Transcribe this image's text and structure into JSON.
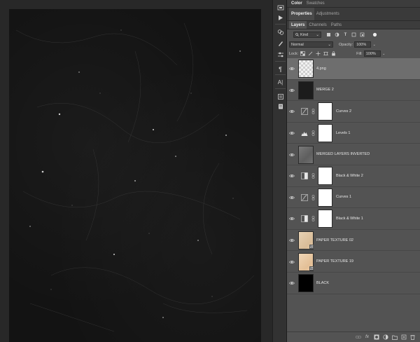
{
  "panels": {
    "top_tabs": [
      "Color",
      "Swatches"
    ],
    "mid_tabs": [
      "Properties",
      "Adjustments"
    ],
    "layer_tabs": [
      "Layers",
      "Channels",
      "Paths"
    ]
  },
  "layers_panel": {
    "filter_kind": "Kind",
    "blend_mode": "Normal",
    "opacity_label": "Opacity:",
    "opacity_value": "100%",
    "lock_label": "Lock:",
    "fill_label": "Fill:",
    "fill_value": "100%"
  },
  "layers": [
    {
      "name": "4.png",
      "kind": "transparent",
      "selected": true
    },
    {
      "name": "MERGE 2",
      "kind": "dark"
    },
    {
      "name": "Curves 2",
      "kind": "adjustment",
      "icon": "curves-icon"
    },
    {
      "name": "Levels 1",
      "kind": "adjustment",
      "icon": "levels-icon"
    },
    {
      "name": "MERGED LAYERS INVERTED",
      "kind": "grey"
    },
    {
      "name": "Black & White 2",
      "kind": "adjustment",
      "icon": "black-white-icon"
    },
    {
      "name": "Curves 1",
      "kind": "adjustment",
      "icon": "curves-icon"
    },
    {
      "name": "Black & White 1",
      "kind": "adjustment",
      "icon": "black-white-icon"
    },
    {
      "name": "PAPER TEXTURE 02",
      "kind": "paper",
      "smart": true
    },
    {
      "name": "PAPER TEXTURE 19",
      "kind": "paper2",
      "smart": true
    },
    {
      "name": "BLACK",
      "kind": "black"
    }
  ],
  "colors": {
    "panel_bg": "#535353",
    "selected_row": "#6e6e6e",
    "canvas": "#131313",
    "paper": "#e1c7a4"
  }
}
